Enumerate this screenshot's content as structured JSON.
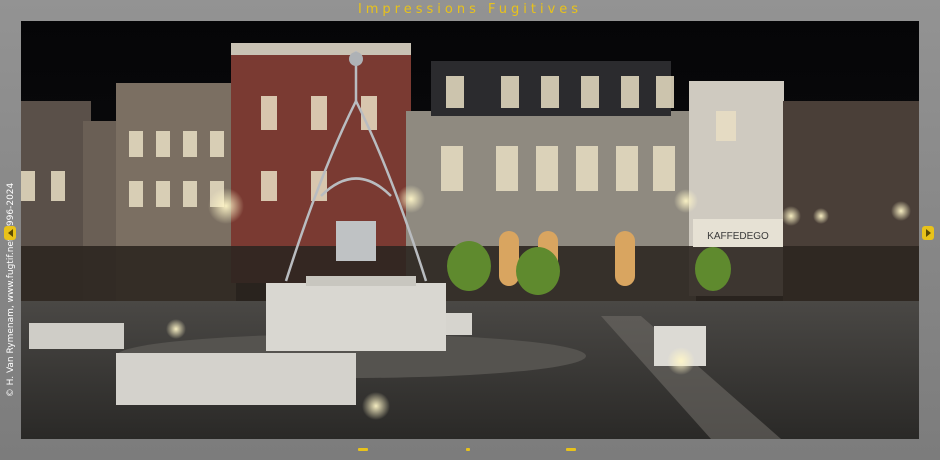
{
  "gallery": {
    "title": "Impressions  Fugitives",
    "credit": "© H. Van Rymenam,  www.fugtif.net,  1996-2024"
  },
  "photo": {
    "storefront_sign": "KAFFEDEGO"
  },
  "icons": {
    "prev": "chevron-left-icon",
    "next": "chevron-right-icon"
  },
  "colors": {
    "accent": "#e8c21a",
    "frame": "#8a8a8a"
  }
}
